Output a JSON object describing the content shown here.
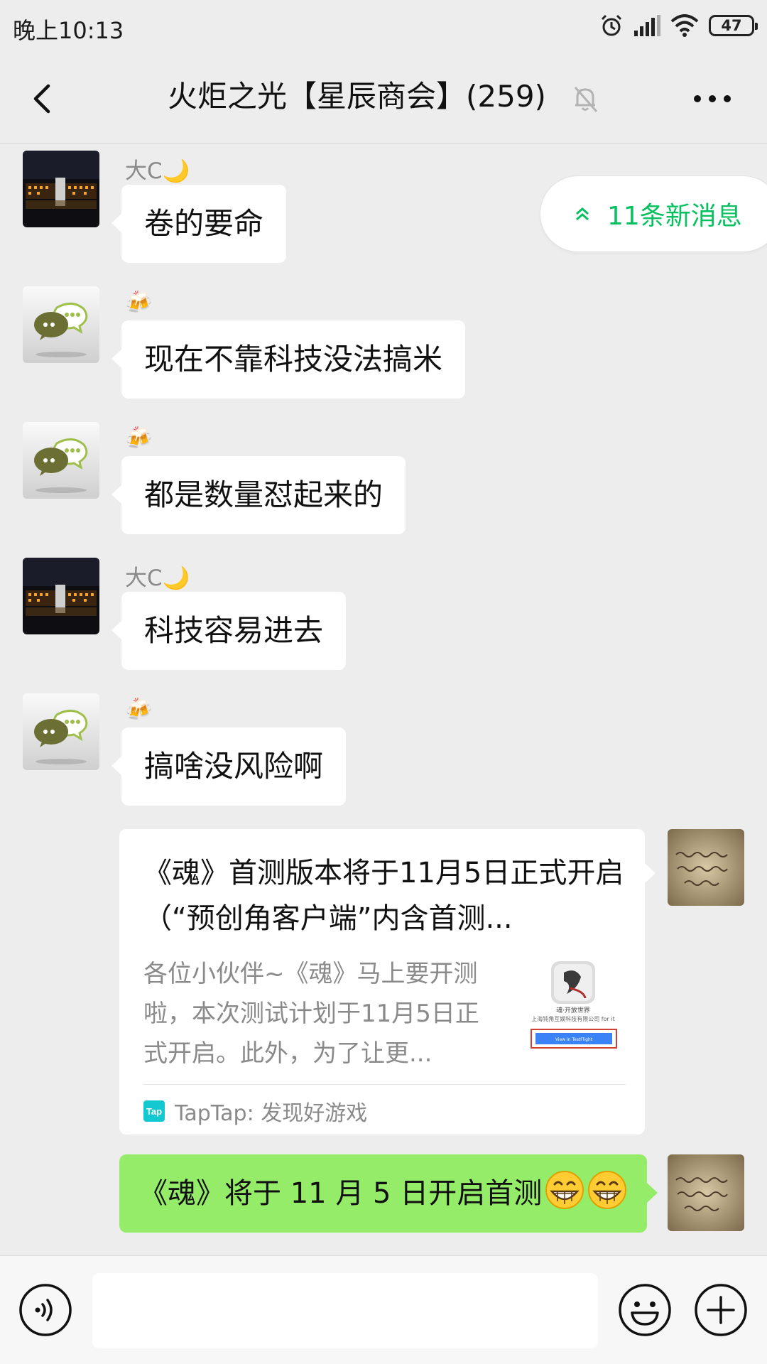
{
  "status_bar": {
    "time": "晚上10:13",
    "battery": "47",
    "icons": [
      "alarm-icon",
      "signal-icon",
      "wifi-icon",
      "battery-icon"
    ]
  },
  "header": {
    "title": "火炬之光【星辰商会】(259)",
    "icons": [
      "back-arrow-icon",
      "mute-bell-icon",
      "more-dots-icon"
    ]
  },
  "new_messages": {
    "label": "11条新消息",
    "icon": "double-chevron-up-icon",
    "color": "#07c160"
  },
  "messages": [
    {
      "sender": "大C🌙",
      "text": "卷的要命",
      "avatar": "night-building-avatar"
    },
    {
      "sender": "🍻",
      "text": "现在不靠科技没法搞米",
      "avatar": "chat-bubbles-avatar"
    },
    {
      "sender": "🍻",
      "text": "都是数量怼起来的",
      "avatar": "chat-bubbles-avatar"
    },
    {
      "sender": "大C🌙",
      "text": "科技容易进去",
      "avatar": "night-building-avatar"
    },
    {
      "sender": "🍻",
      "text": "搞啥没风险啊",
      "avatar": "chat-bubbles-avatar"
    }
  ],
  "link_card": {
    "title": "《魂》首测版本将于11月5日正式开启（“预创角客户端”内含首测...",
    "description": "各位小伙伴~《魂》马上要开测啦，本次测试计划于11月5日正式开启。此外，为了让更...",
    "source": "TapTap: 发现好游戏",
    "source_logo": "Tap",
    "thumb_text_1": "魂·开放世界",
    "thumb_text_2": "上海钝角互娱科技有限公司 for it",
    "thumb_button": "View in TestFlight"
  },
  "my_message": {
    "text": "《魂》将于 11 月 5 日开启首测",
    "emoji": [
      "grinning-face-emoji",
      "grinning-face-emoji"
    ],
    "avatar": "handwriting-avatar"
  },
  "colors": {
    "accent_green": "#07c160",
    "my_bubble": "#95ec69",
    "background": "#ededed"
  },
  "input_bar": {
    "placeholder": "",
    "icons": [
      "voice-icon",
      "emoji-icon",
      "plus-icon"
    ]
  }
}
